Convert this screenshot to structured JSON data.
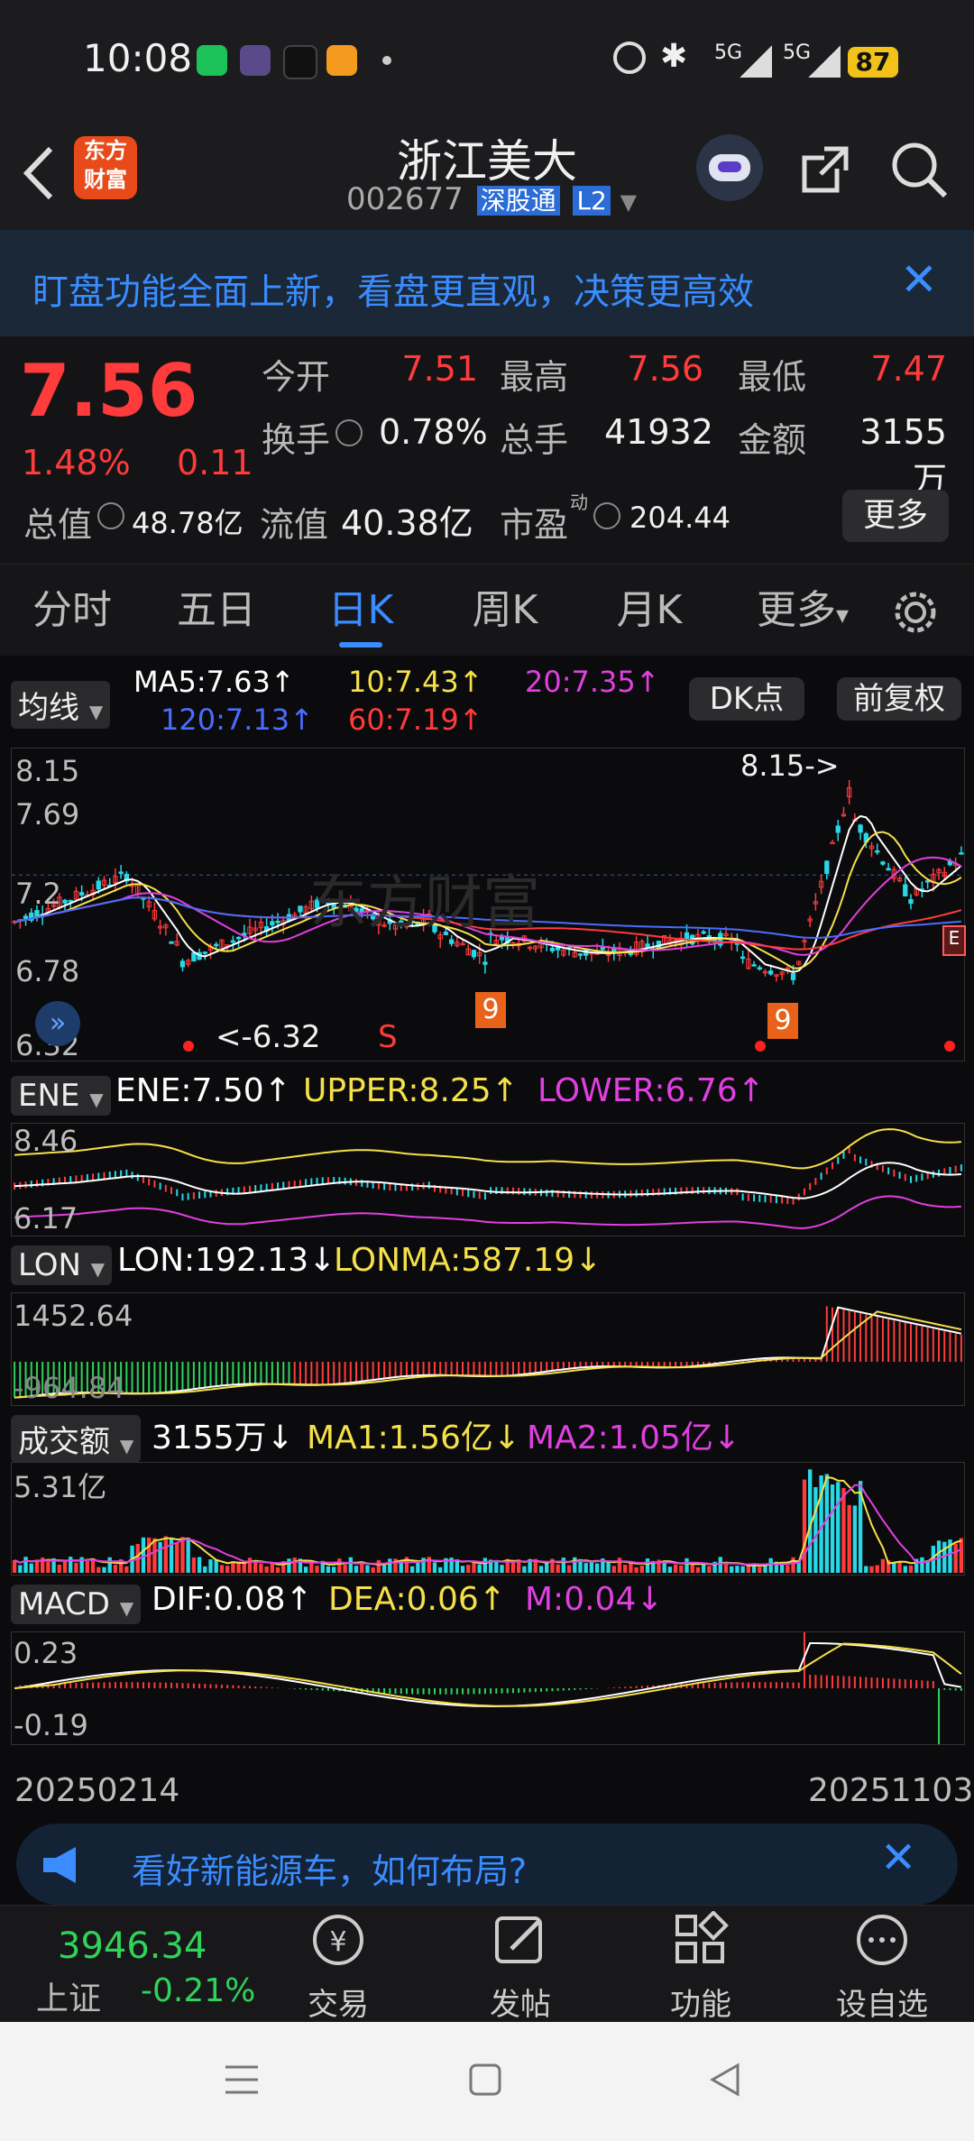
{
  "status_bar": {
    "time": "10:08",
    "battery": "87",
    "network": "5G"
  },
  "header": {
    "title": "浙江美大",
    "code": "002677",
    "connect_badge": "深股通",
    "level_badge": "L2",
    "logo_text_top": "东方",
    "logo_text_bottom": "财富"
  },
  "banner": {
    "text": "盯盘功能全面上新，看盘更直观，决策更高效"
  },
  "quote": {
    "price": "7.56",
    "change_pct": "1.48%",
    "change_amt": "0.11",
    "rows": [
      [
        {
          "label": "今开",
          "value": "7.51",
          "color": "red"
        },
        {
          "label": "最高",
          "value": "7.56",
          "color": "red"
        },
        {
          "label": "最低",
          "value": "7.47",
          "color": "red"
        }
      ],
      [
        {
          "label": "换手",
          "value": "0.78%",
          "color": "white"
        },
        {
          "label": "总手",
          "value": "41932",
          "color": "white"
        },
        {
          "label": "金额",
          "value": "3155万",
          "color": "white"
        }
      ]
    ],
    "total_value_label": "总值",
    "total_value": "48.78亿",
    "float_value_label": "流值",
    "float_value": "40.38亿",
    "pe_label": "市盈",
    "pe_sup": "动",
    "pe_value": "204.44",
    "more_button": "更多"
  },
  "tabs": [
    "分时",
    "五日",
    "日K",
    "周K",
    "月K",
    "更多"
  ],
  "active_tab_index": 2,
  "main_chart": {
    "indicator_select": "均线",
    "ma5": "MA5:7.63↑",
    "ma10": "10:7.43↑",
    "ma20": "20:7.35↑",
    "ma120": "120:7.13↑",
    "ma60": "60:7.19↑",
    "dk_button": "DK点",
    "adjust_button": "前复权",
    "y_labels": [
      "8.15",
      "7.69",
      "7.2",
      "6.78",
      "6.32"
    ],
    "high_marker": "8.15->",
    "low_marker": "<-6.32",
    "s_marker": "S",
    "nine_markers": [
      "9",
      "9"
    ],
    "watermark": "东方财富"
  },
  "ene_panel": {
    "select": "ENE",
    "ene": "ENE:7.50↑",
    "upper": "UPPER:8.25↑",
    "lower": "LOWER:6.76↑",
    "y_top": "8.46",
    "y_bottom": "6.17"
  },
  "lon_panel": {
    "select": "LON",
    "lon": "LON:192.13↓",
    "lonma": "LONMA:587.19↓",
    "y_top": "1452.64",
    "y_bottom": "-964.84"
  },
  "vol_panel": {
    "select": "成交额",
    "value": "3155万↓",
    "ma1": "MA1:1.56亿↓",
    "ma2": "MA2:1.05亿↓",
    "y_top": "5.31亿"
  },
  "macd_panel": {
    "select": "MACD",
    "dif": "DIF:0.08↑",
    "dea": "DEA:0.06↑",
    "m": "M:0.04↓",
    "y_top": "0.23",
    "y_bottom": "-0.19"
  },
  "date_axis": {
    "start": "20250214",
    "end": "20251103"
  },
  "ad": {
    "text": "看好新能源车，如何布局?"
  },
  "bottom_nav": {
    "index_value": "3946.34",
    "index_name": "上证",
    "index_change": "-0.21%",
    "items": [
      "交易",
      "发帖",
      "功能",
      "设自选"
    ]
  },
  "colors": {
    "up": "#ff3b3b",
    "down": "#2fd35a",
    "accent": "#3a8cff",
    "ma5": "#ffffff",
    "ma10": "#f5e04a",
    "ma20": "#e040e0",
    "ma60": "#ff3b3b",
    "ma120": "#4a6cff"
  }
}
